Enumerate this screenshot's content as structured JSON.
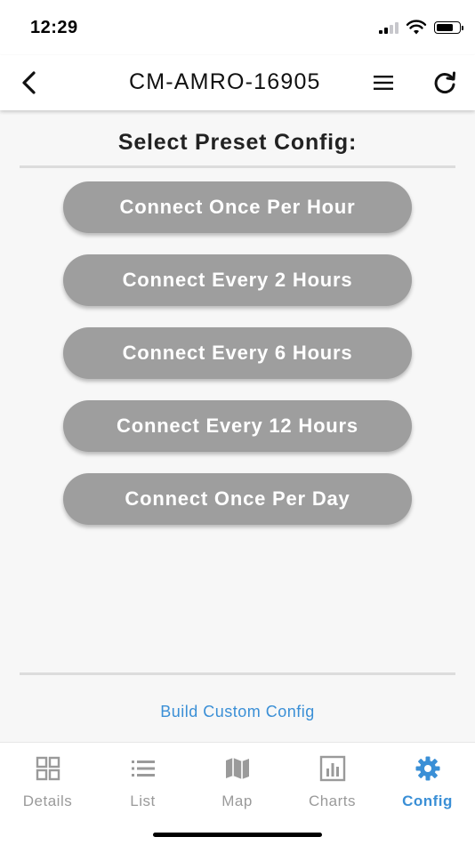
{
  "status_bar": {
    "time": "12:29",
    "icons": [
      "cellular-signal-icon",
      "wifi-icon",
      "battery-icon"
    ]
  },
  "header": {
    "title": "CM-AMRO-16905",
    "back_icon": "chevron-left-icon",
    "menu_icon": "hamburger-menu-icon",
    "refresh_icon": "refresh-icon"
  },
  "main": {
    "section_title": "Select Preset Config:",
    "presets": [
      {
        "label": "Connect Once Per Hour"
      },
      {
        "label": "Connect Every 2 Hours"
      },
      {
        "label": "Connect Every 6 Hours"
      },
      {
        "label": "Connect Every 12 Hours"
      },
      {
        "label": "Connect Once Per Day"
      }
    ],
    "custom_link": "Build Custom Config"
  },
  "tab_bar": {
    "tabs": [
      {
        "label": "Details",
        "icon": "grid-icon",
        "active": false
      },
      {
        "label": "List",
        "icon": "list-icon",
        "active": false
      },
      {
        "label": "Map",
        "icon": "map-icon",
        "active": false
      },
      {
        "label": "Charts",
        "icon": "bar-chart-icon",
        "active": false
      },
      {
        "label": "Config",
        "icon": "gear-icon",
        "active": true
      }
    ]
  },
  "colors": {
    "accent": "#3a8fd6",
    "preset_button_bg": "#9e9e9e",
    "tab_inactive": "#9a9a9a",
    "content_bg": "#f7f7f7"
  }
}
